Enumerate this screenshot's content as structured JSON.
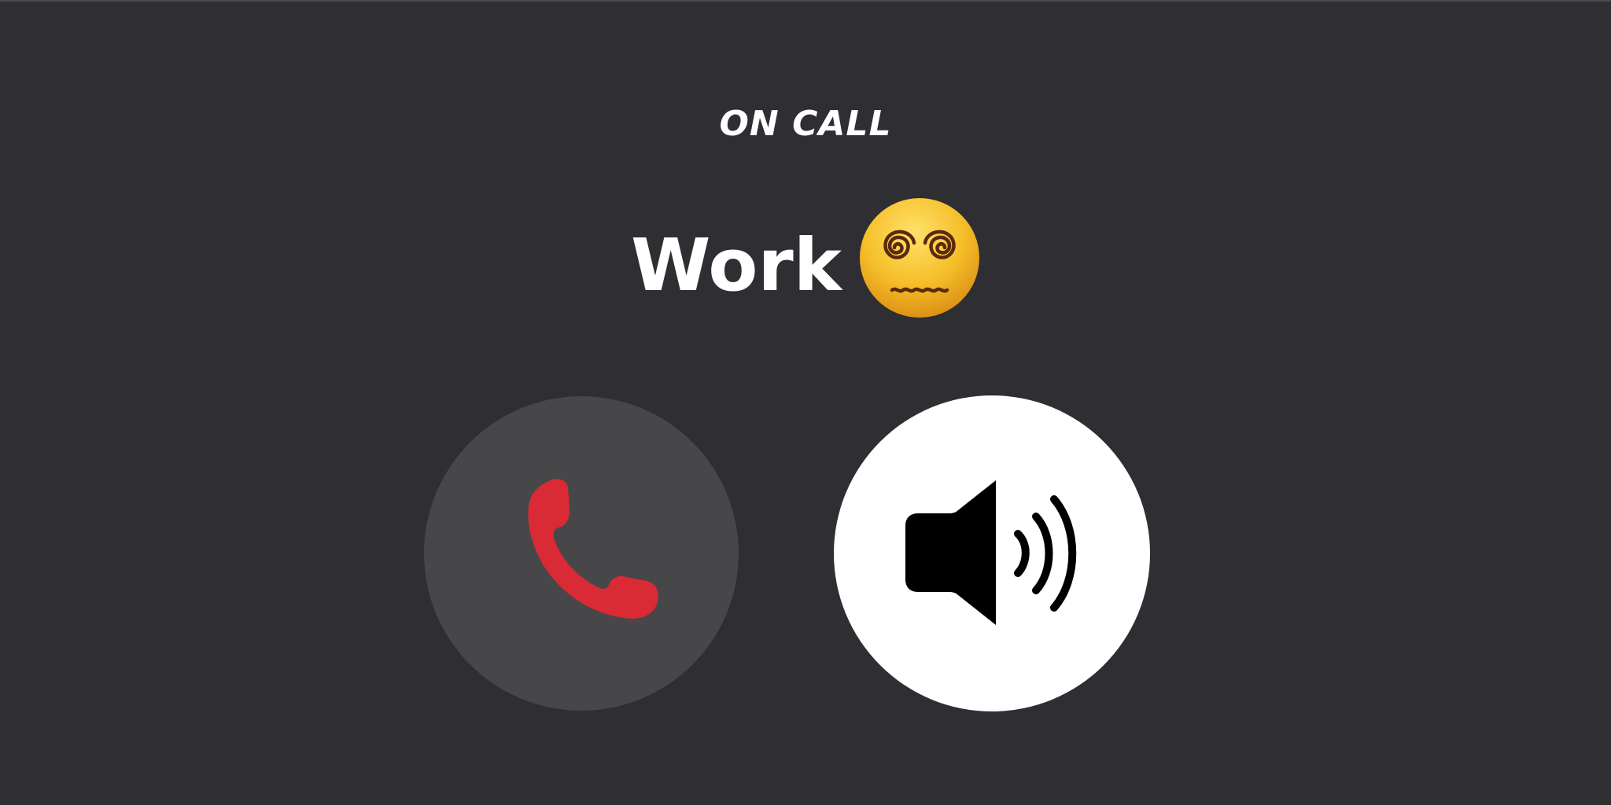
{
  "call": {
    "status": "ON CALL",
    "caller_name": "Work",
    "caller_emoji": "face-with-spiral-eyes-icon"
  },
  "buttons": {
    "end_call": {
      "icon": "phone-handset-icon",
      "color": "#d92a35"
    },
    "speaker": {
      "icon": "speaker-volume-icon",
      "color": "#000000"
    }
  },
  "colors": {
    "background": "#2e2e33",
    "end_button_bg": "#474749",
    "speaker_button_bg": "#ffffff",
    "text": "#ffffff"
  }
}
